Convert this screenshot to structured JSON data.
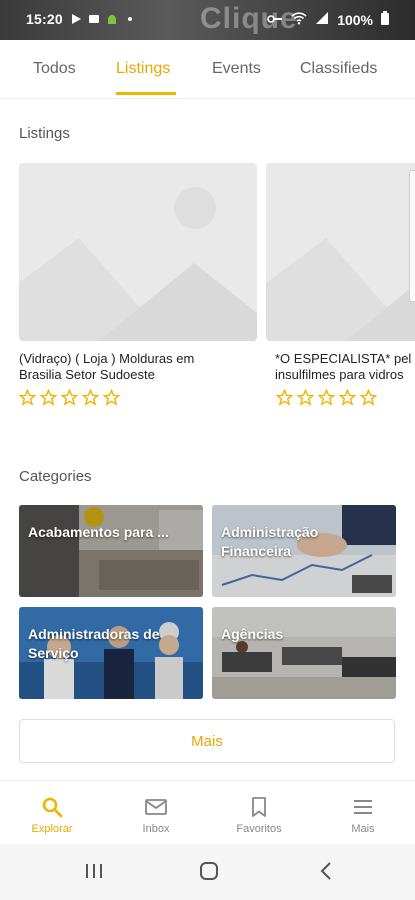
{
  "status_bar": {
    "time": "15:20",
    "battery": "100%",
    "watermark": "Clique"
  },
  "tabs": [
    {
      "label": "Todos",
      "active": false
    },
    {
      "label": "Listings",
      "active": true
    },
    {
      "label": "Events",
      "active": false
    },
    {
      "label": "Classifieds",
      "active": false
    }
  ],
  "listings": {
    "section_title": "Listings",
    "items": [
      {
        "title_line1": "(Vidraço) ( Loja ) Molduras em",
        "title_line2": "Brasilia Setor Sudoeste",
        "rating": 0,
        "max_rating": 5
      },
      {
        "title_line1": "*O ESPECIALISTA* pel",
        "title_line2": "insulfilmes para vidros",
        "rating": 0,
        "max_rating": 5
      }
    ]
  },
  "categories": {
    "section_title": "Categories",
    "items": [
      {
        "label": "Acabamentos para ..."
      },
      {
        "label": "Administração Financeira"
      },
      {
        "label": "Administradoras de Serviço"
      },
      {
        "label": "Agências"
      }
    ],
    "more_label": "Mais"
  },
  "bottom_nav": [
    {
      "label": "Explorar",
      "icon": "search-icon",
      "active": true
    },
    {
      "label": "Inbox",
      "icon": "mail-icon",
      "active": false
    },
    {
      "label": "Favoritos",
      "icon": "bookmark-icon",
      "active": false
    },
    {
      "label": "Mais",
      "icon": "menu-icon",
      "active": false
    }
  ],
  "colors": {
    "accent": "#f0b400",
    "star": "#f0b400"
  }
}
